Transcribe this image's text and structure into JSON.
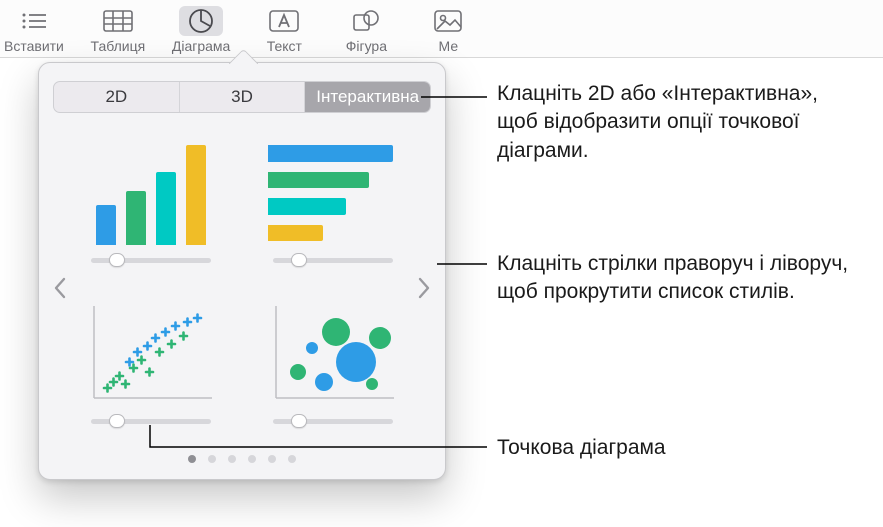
{
  "toolbar": {
    "items": [
      {
        "label": "Вставити",
        "icon": "toc"
      },
      {
        "label": "Таблиця",
        "icon": "table"
      },
      {
        "label": "Діаграма",
        "icon": "chart",
        "active": true
      },
      {
        "label": "Текст",
        "icon": "text"
      },
      {
        "label": "Фігура",
        "icon": "shape"
      },
      {
        "label": "Ме",
        "icon": "media"
      }
    ]
  },
  "popover": {
    "tabs": {
      "t2d": "2D",
      "t3d": "3D",
      "tint": "Інтерактивна",
      "selected": "Інтерактивна"
    },
    "thumbs": {
      "vbar": {
        "name": "vertical-bar-chart"
      },
      "hbar": {
        "name": "horizontal-bar-chart"
      },
      "scatter": {
        "name": "scatter-chart"
      },
      "bubble": {
        "name": "bubble-chart"
      }
    },
    "pager": {
      "count": 6,
      "active": 0
    },
    "colors": {
      "c1": "#2e9ce6",
      "c2": "#2fb574",
      "c3": "#00c9c3",
      "c4": "#f0bd27"
    }
  },
  "callouts": {
    "c1": "Клацніть 2D або «Інтерактивна», щоб відобразити опції точкової діаграми.",
    "c2": "Клацніть стрілки праворуч і ліворуч, щоб прокрутити список стилів.",
    "c3": "Точкова діаграма"
  }
}
